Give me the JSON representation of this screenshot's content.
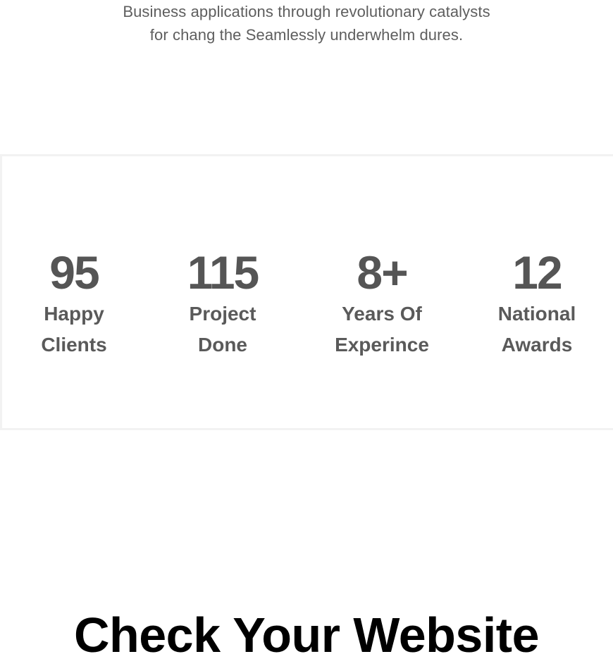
{
  "intro": {
    "lines": [
      "Business applications through revolutionary catalysts",
      "for chang the Seamlessly underwhelm dures."
    ]
  },
  "stats": [
    {
      "number": "95",
      "label_lines": [
        "Happy",
        "Clients"
      ]
    },
    {
      "number": "115",
      "label_lines": [
        "Project",
        "Done"
      ]
    },
    {
      "number": "8+",
      "label_lines": [
        "Years Of",
        "Experince"
      ]
    },
    {
      "number": "12",
      "label_lines": [
        "National",
        "Awards"
      ]
    }
  ],
  "section": {
    "title": "Check Your Website"
  },
  "colors": {
    "stat_text": "#555555",
    "panel_border": "#f2f2f2",
    "title": "#000000"
  }
}
